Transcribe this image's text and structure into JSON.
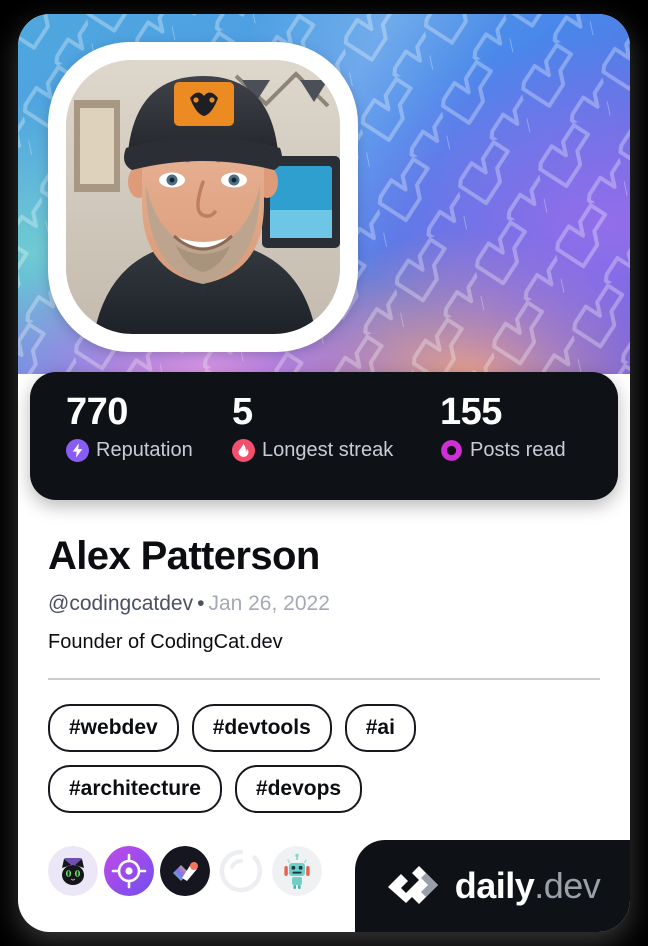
{
  "card": {
    "accent_colors": {
      "panel_dark": "#0e1217",
      "reputation": "#8a5cf6",
      "streak": "#f3506e",
      "posts_read": "#cf2fd4",
      "card_background": "#ffffff"
    }
  },
  "avatar": {
    "alt": "Alex Patterson profile photo"
  },
  "stats": [
    {
      "value": "770",
      "label": "Reputation",
      "icon": "bolt-icon"
    },
    {
      "value": "5",
      "label": "Longest streak",
      "icon": "flame-icon"
    },
    {
      "value": "155",
      "label": "Posts read",
      "icon": "eye-ring-icon"
    }
  ],
  "profile": {
    "name": "Alex Patterson",
    "handle": "@codingcatdev",
    "separator": "•",
    "joined": "Jan 26, 2022",
    "bio": "Founder of CodingCat.dev"
  },
  "tags": [
    {
      "label": "#webdev"
    },
    {
      "label": "#devtools"
    },
    {
      "label": "#ai"
    },
    {
      "label": "#architecture"
    },
    {
      "label": "#devops"
    }
  ],
  "badges": [
    {
      "name": "black-cat-badge"
    },
    {
      "name": "target-badge"
    },
    {
      "name": "gradient-logo-badge"
    },
    {
      "name": "locked-ring-badge"
    },
    {
      "name": "robot-badge"
    }
  ],
  "brand": {
    "name": "daily",
    "suffix": ".dev",
    "mark": "daily-dev-logo-icon"
  }
}
